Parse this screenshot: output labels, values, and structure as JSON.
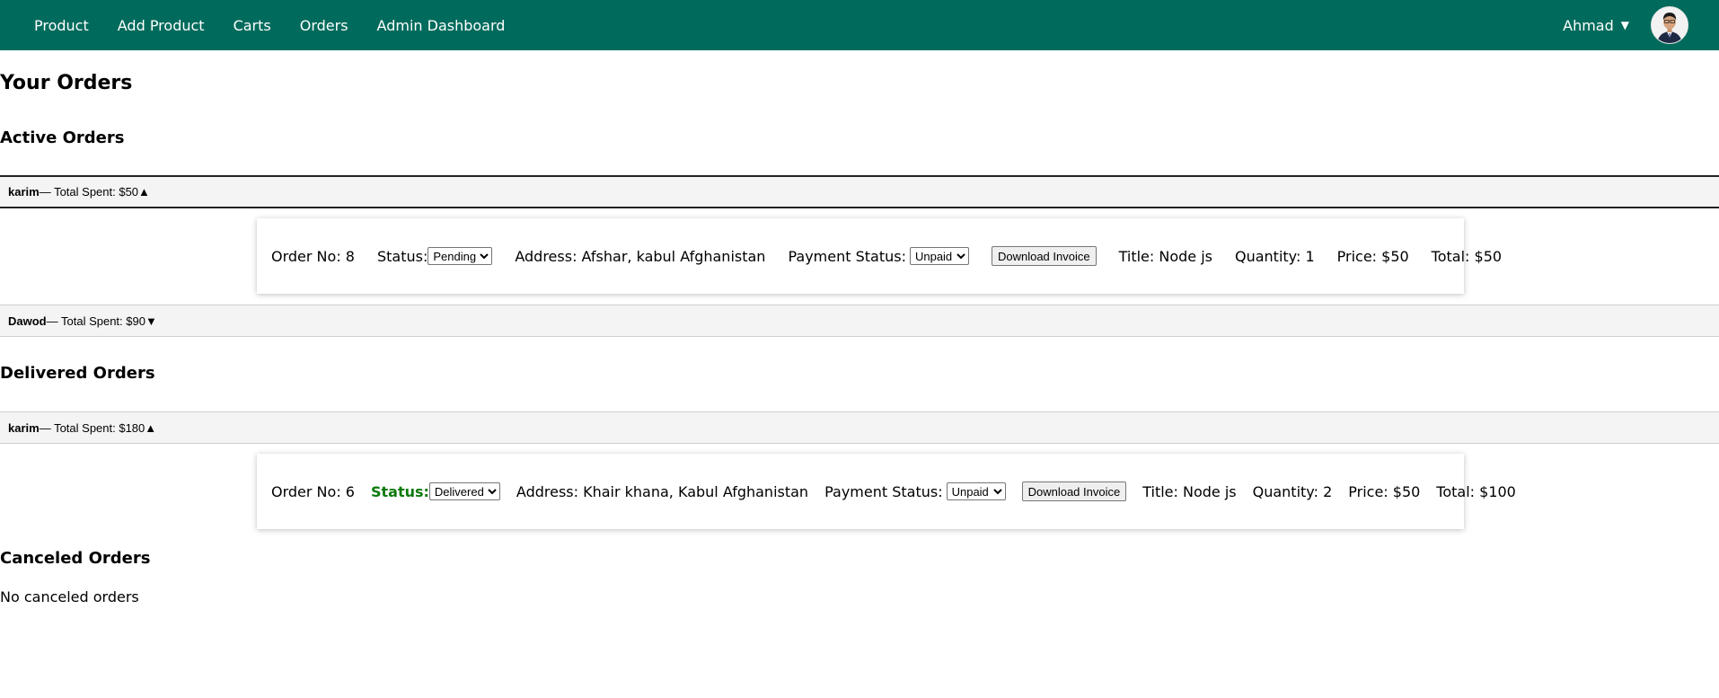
{
  "nav": {
    "links": [
      "Product",
      "Add Product",
      "Carts",
      "Orders",
      "Admin Dashboard"
    ],
    "user_name": "Ahmad",
    "caret": "▼"
  },
  "page_title": "Your Orders",
  "active": {
    "title": "Active Orders",
    "customers": [
      {
        "name": "karim",
        "summary": " — Total Spent: $50",
        "toggle": "▲",
        "order": {
          "order_no": "Order No: 8",
          "status_label": "Status:",
          "status_value": "Pending",
          "address": "Address: Afshar, kabul Afghanistan",
          "payment_label": "Payment Status:",
          "payment_value": "Unpaid",
          "invoice_button": "Download Invoice",
          "title": "Title: Node js",
          "quantity": "Quantity: 1",
          "price": "Price: $50",
          "total": "Total: $50"
        }
      },
      {
        "name": "Dawod",
        "summary": " — Total Spent: $90",
        "toggle": "▼"
      }
    ]
  },
  "delivered": {
    "title": "Delivered Orders",
    "customers": [
      {
        "name": "karim",
        "summary": " — Total Spent: $180",
        "toggle": "▲",
        "order": {
          "order_no": "Order No: 6",
          "status_label": "Status:",
          "status_value": "Delivered",
          "address": "Address: Khair khana, Kabul Afghanistan",
          "payment_label": "Payment Status:",
          "payment_value": "Unpaid",
          "invoice_button": "Download Invoice",
          "title": "Title: Node js",
          "quantity": "Quantity: 2",
          "price": "Price: $50",
          "total": "Total: $100"
        }
      }
    ]
  },
  "canceled": {
    "title": "Canceled Orders",
    "empty_text": "No canceled orders"
  },
  "colors": {
    "navbar": "#006b5c",
    "delivered_status": "#0b7a0b"
  }
}
